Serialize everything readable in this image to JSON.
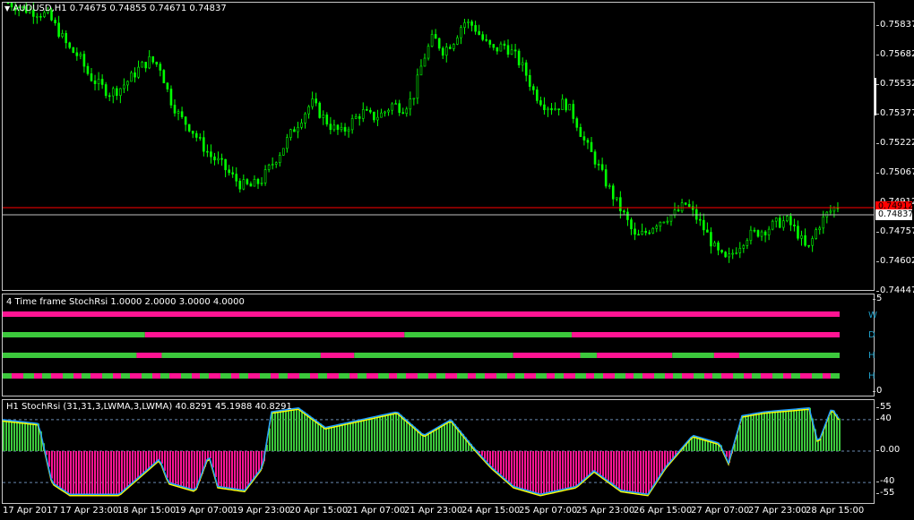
{
  "main": {
    "symbol_title": "AUDUSD,H1  0.74675 0.74855 0.74671 0.74837",
    "current_price": "0.74837",
    "bid_line_price": "0.74912",
    "price_ticks": [
      "0.75837",
      "0.75682",
      "0.75532",
      "0.75377",
      "0.75222",
      "0.75067",
      "0.74912",
      "0.74757",
      "0.74602",
      "0.74447"
    ],
    "colors": {
      "candle": "#00ff00",
      "background": "#000000",
      "ask_line": "#ff0000",
      "bid_line": "#c0c0c0"
    }
  },
  "mtf": {
    "title": "4 Time frame StochRsi 1.0000 2.0000 3.0000 4.0000",
    "y_top": "5",
    "y_bottom": "0",
    "row_labels": [
      "W",
      "D",
      "H",
      "H"
    ],
    "rows": [
      {
        "segments": [
          [
            "#ff1493",
            1.0
          ]
        ]
      },
      {
        "segments": [
          [
            "#3cc83c",
            0.17
          ],
          [
            "#ff1493",
            0.31
          ],
          [
            "#3cc83c",
            0.2
          ],
          [
            "#ff1493",
            0.32
          ]
        ]
      },
      {
        "segments": [
          [
            "#3cc83c",
            0.16
          ],
          [
            "#ff1493",
            0.03
          ],
          [
            "#3cc83c",
            0.19
          ],
          [
            "#ff1493",
            0.04
          ],
          [
            "#3cc83c",
            0.19
          ],
          [
            "#ff1493",
            0.08
          ],
          [
            "#3cc83c",
            0.02
          ],
          [
            "#ff1493",
            0.09
          ],
          [
            "#3cc83c",
            0.05
          ],
          [
            "#ff1493",
            0.03
          ],
          [
            "#3cc83c",
            0.12
          ]
        ]
      },
      {
        "pattern": "alternating"
      }
    ]
  },
  "osc": {
    "title": "H1  StochRsi (31,31,3,LWMA,3,LWMA) 40.8291 45.1988 40.8291",
    "levels": [
      "55",
      "40",
      "0.00",
      "-40",
      "-55"
    ],
    "level_values": [
      55,
      40,
      0,
      -40,
      -55
    ],
    "colors": {
      "up": "#3cc83c",
      "down": "#ff1493",
      "line1": "#1e9fff",
      "line2": "#ffff00"
    }
  },
  "x_ticks": [
    "17 Apr 2017",
    "17 Apr 23:00",
    "18 Apr 15:00",
    "19 Apr 07:00",
    "19 Apr 23:00",
    "20 Apr 15:00",
    "21 Apr 07:00",
    "21 Apr 23:00",
    "24 Apr 15:00",
    "25 Apr 07:00",
    "25 Apr 23:00",
    "26 Apr 15:00",
    "27 Apr 07:00",
    "27 Apr 23:00",
    "28 Apr 15:00"
  ],
  "chart_data": {
    "type": "candlestick",
    "symbol": "AUDUSD",
    "timeframe": "H1",
    "y_range": [
      0.744,
      0.759
    ],
    "close_path": [
      0.759,
      0.7588,
      0.7586,
      0.7585,
      0.7583,
      0.7575,
      0.7566,
      0.7562,
      0.7552,
      0.7547,
      0.7543,
      0.7545,
      0.755,
      0.7556,
      0.756,
      0.7557,
      0.754,
      0.753,
      0.7525,
      0.7517,
      0.751,
      0.7506,
      0.75,
      0.7495,
      0.7494,
      0.7497,
      0.7505,
      0.7513,
      0.7522,
      0.753,
      0.7538,
      0.7531,
      0.7525,
      0.7522,
      0.7528,
      0.7533,
      0.753,
      0.7532,
      0.7537,
      0.7535,
      0.754,
      0.756,
      0.7572,
      0.7565,
      0.757,
      0.758,
      0.7578,
      0.757,
      0.7565,
      0.7568,
      0.7563,
      0.7555,
      0.7543,
      0.7537,
      0.7535,
      0.7538,
      0.753,
      0.7517,
      0.7508,
      0.7497,
      0.7487,
      0.7478,
      0.7467,
      0.747,
      0.7475,
      0.7478,
      0.748,
      0.7485,
      0.7478,
      0.747,
      0.746,
      0.7455,
      0.7462,
      0.7468,
      0.747,
      0.7472,
      0.7475,
      0.7476,
      0.747,
      0.746,
      0.7473,
      0.748,
      0.7484
    ]
  }
}
